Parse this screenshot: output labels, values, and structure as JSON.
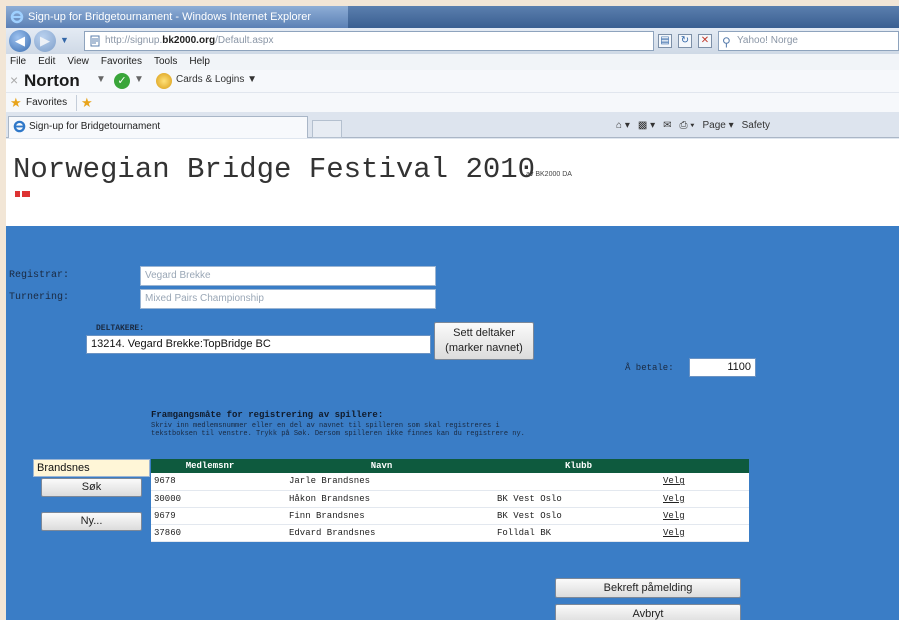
{
  "window": {
    "title": "Sign-up for Bridgetournament - Windows Internet Explorer"
  },
  "address_bar": {
    "url_prefix": "http://signup.",
    "url_domain": "bk2000.org",
    "url_path": "/Default.aspx",
    "search_placeholder": "Yahoo! Norge"
  },
  "menu": [
    "File",
    "Edit",
    "View",
    "Favorites",
    "Tools",
    "Help"
  ],
  "norton": {
    "logo": "Norton",
    "cards_label": "Cards & Logins"
  },
  "favorites": {
    "label": "Favorites"
  },
  "tab": {
    "title": "Sign-up for Bridgetournament"
  },
  "command_bar": {
    "page_label": "Page",
    "safety_label": "Safety"
  },
  "page": {
    "title": "Norwegian Bridge Festival 2010",
    "subtitle": "av BK2000 DA",
    "registrar_label": "Registrar:",
    "registrar_value": "Vegard Brekke",
    "turnering_label": "Turnering:",
    "turnering_value": "Mixed Pairs Championship",
    "deltakere_label": "DELTAKERE:",
    "deltakere_value": "13214. Vegard Brekke:TopBridge BC",
    "sett_deltaker_button": "Sett deltaker (marker navnet)",
    "betale_label": "Å betale:",
    "betale_value": "1100",
    "instructions_heading": "Framgangsmåte for registrering av spillere:",
    "instructions_text": "Skriv inn medlemsnummer eller en del av navnet til spilleren som skal registreres i tekstboksen til venstre. Trykk på Søk. Dersom spilleren ikke finnes kan du registrere ny.",
    "search_value": "Brandsnes",
    "sok_button": "Søk",
    "ny_button": "Ny...",
    "results": {
      "headers": [
        "Medlemsnr",
        "Navn",
        "Klubb",
        ""
      ],
      "rows": [
        {
          "medlemsnr": "9678",
          "navn": "Jarle Brandsnes",
          "klubb": "",
          "velg": "Velg"
        },
        {
          "medlemsnr": "30000",
          "navn": "Håkon Brandsnes",
          "klubb": "BK Vest Oslo",
          "velg": "Velg"
        },
        {
          "medlemsnr": "9679",
          "navn": "Finn Brandsnes",
          "klubb": "BK Vest Oslo",
          "velg": "Velg"
        },
        {
          "medlemsnr": "37860",
          "navn": "Edvard Brandsnes",
          "klubb": "Folldal BK",
          "velg": "Velg"
        }
      ]
    },
    "bekreft_button": "Bekreft påmelding",
    "avbryt_button": "Avbryt"
  }
}
